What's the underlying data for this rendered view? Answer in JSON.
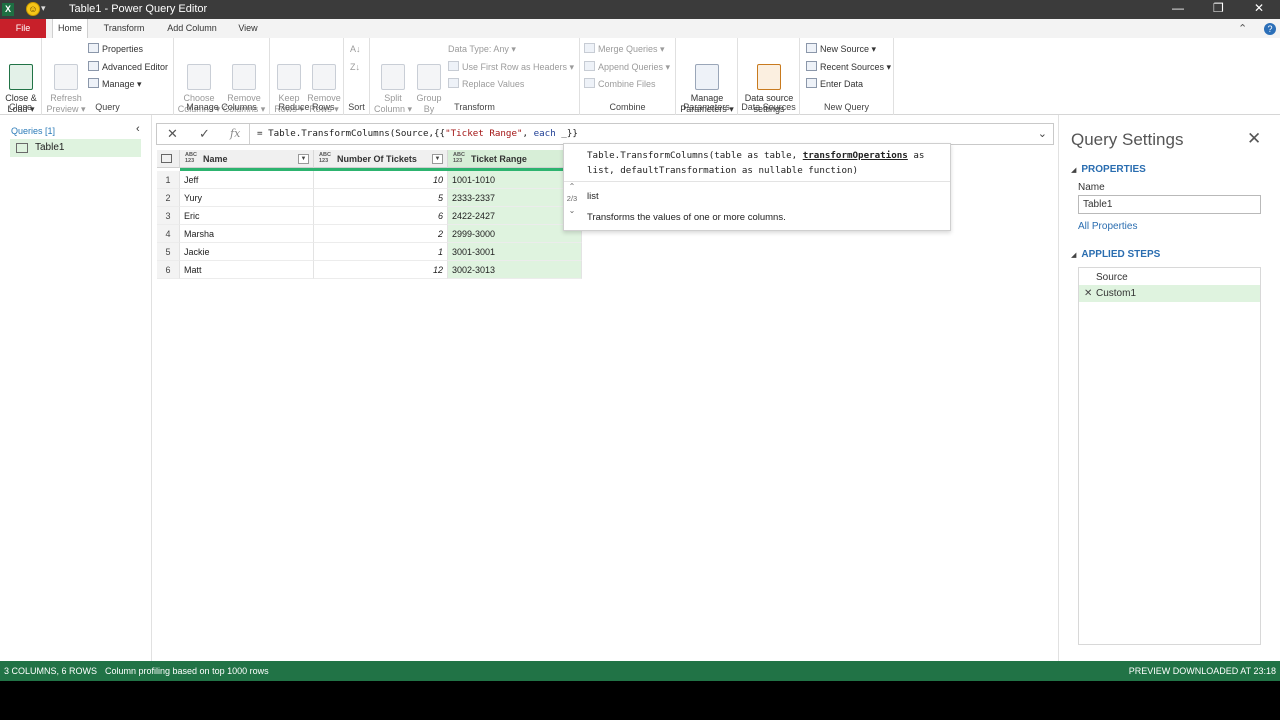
{
  "window": {
    "app_icon": "X",
    "title": "Table1 - Power Query Editor",
    "quick_access": "▾",
    "min": "—",
    "restore": "❐",
    "close": "✕"
  },
  "tabs": [
    {
      "label": "File"
    },
    {
      "label": "Home"
    },
    {
      "label": "Transform"
    },
    {
      "label": "Add Column"
    },
    {
      "label": "View"
    }
  ],
  "ribbon": {
    "close_group": {
      "label": "Close",
      "close_load": "Close &\nLoad ▾"
    },
    "query_group": {
      "label": "Query",
      "refresh": "Refresh\nPreview ▾",
      "properties": "Properties",
      "advanced_editor": "Advanced Editor",
      "manage": "Manage ▾"
    },
    "manage_columns_group": {
      "label": "Manage Columns",
      "choose": "Choose\nColumns ▾",
      "remove": "Remove\nColumns ▾"
    },
    "reduce_rows_group": {
      "label": "Reduce Rows",
      "keep": "Keep\nRows ▾",
      "remove": "Remove\nRows ▾"
    },
    "sort_group": {
      "label": "Sort"
    },
    "transform_group": {
      "label": "Transform",
      "split": "Split\nColumn ▾",
      "group_by": "Group\nBy",
      "data_type": "Data Type: Any ▾",
      "first_row": "Use First Row as Headers ▾",
      "replace": "Replace Values"
    },
    "combine_group": {
      "label": "Combine",
      "merge": "Merge Queries ▾",
      "append": "Append Queries ▾",
      "combine_files": "Combine Files"
    },
    "parameters_group": {
      "label": "Parameters",
      "manage_params": "Manage\nParameters ▾"
    },
    "data_sources_group": {
      "label": "Data Sources",
      "settings": "Data source\nsettings"
    },
    "new_query_group": {
      "label": "New Query",
      "new_source": "New Source ▾",
      "recent_sources": "Recent Sources ▾",
      "enter_data": "Enter Data"
    }
  },
  "queries_pane": {
    "header": "Queries [1]",
    "items": [
      {
        "label": "Table1"
      }
    ]
  },
  "formula_bar": {
    "prefix": "= Table.TransformColumns(Source,{{",
    "string": "\"Ticket Range\"",
    "mid": ", ",
    "keyword": "each",
    "suffix": " _}}"
  },
  "grid": {
    "columns": [
      {
        "type": "ABC\n123",
        "name": "Name"
      },
      {
        "type": "ABC\n123",
        "name": "Number Of Tickets"
      },
      {
        "type": "ABC\n123",
        "name": "Ticket Range"
      }
    ],
    "rows": [
      {
        "n": "1",
        "name": "Jeff",
        "tickets": "10",
        "range": "1001-1010"
      },
      {
        "n": "2",
        "name": "Yury",
        "tickets": "5",
        "range": "2333-2337"
      },
      {
        "n": "3",
        "name": "Eric",
        "tickets": "6",
        "range": "2422-2427"
      },
      {
        "n": "4",
        "name": "Marsha",
        "tickets": "2",
        "range": "2999-3000"
      },
      {
        "n": "5",
        "name": "Jackie",
        "tickets": "1",
        "range": "3001-3001"
      },
      {
        "n": "6",
        "name": "Matt",
        "tickets": "12",
        "range": "3002-3013"
      }
    ]
  },
  "intellisense": {
    "sig_start": "Table.TransformColumns(table as table, ",
    "sig_param": "transformOperations",
    "sig_end": " as list, defaultTransformation as nullable function)",
    "param_type": "list",
    "description": "Transforms the values of one or more columns.",
    "counter": "2/3"
  },
  "query_settings": {
    "title": "Query Settings",
    "properties_header": "PROPERTIES",
    "name_label": "Name",
    "name_value": "Table1",
    "all_properties": "All Properties",
    "steps_header": "APPLIED STEPS",
    "steps": [
      {
        "label": "Source"
      },
      {
        "label": "Custom1"
      }
    ]
  },
  "status_bar": {
    "left": "3 COLUMNS, 6 ROWS",
    "profiling": "Column profiling based on top 1000 rows",
    "right": "PREVIEW DOWNLOADED AT 23:18"
  },
  "colors": {
    "accent_green": "#217346",
    "file_tab": "#c8202a",
    "selected": "#dff3df"
  }
}
